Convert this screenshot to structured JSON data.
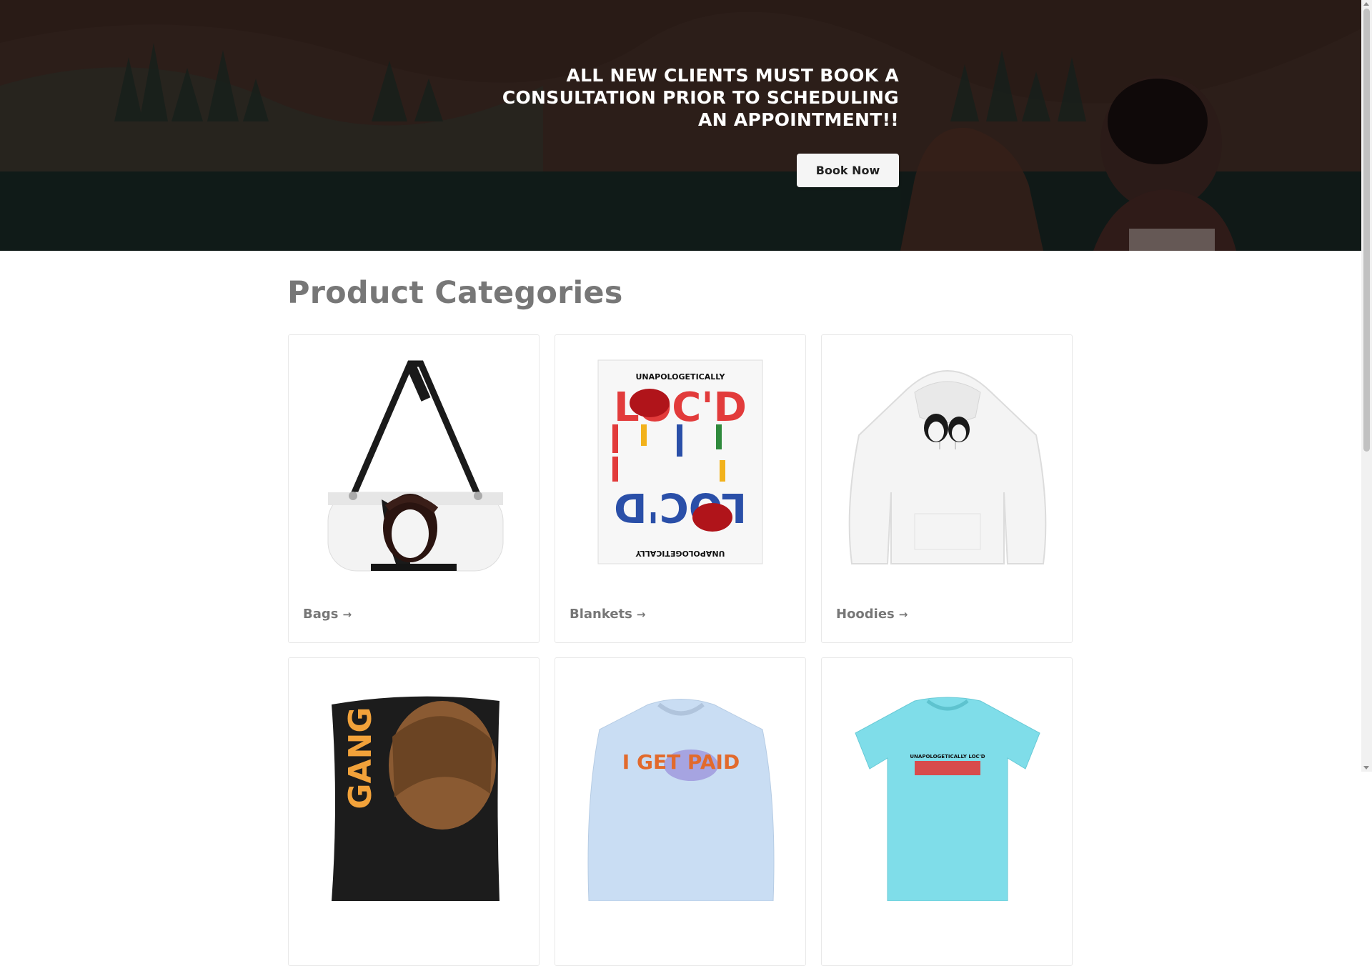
{
  "hero": {
    "heading": "ALL NEW CLIENTS MUST BOOK A CONSULTATION PRIOR TO SCHEDULING AN APPOINTMENT!!",
    "button_label": "Book Now"
  },
  "categories": {
    "title": "Product Categories",
    "items": [
      {
        "label": "Bags",
        "icon": "arrow-right-icon"
      },
      {
        "label": "Blankets",
        "icon": "arrow-right-icon"
      },
      {
        "label": "Hoodies",
        "icon": "arrow-right-icon"
      },
      {
        "label": "",
        "image_text": "GANG"
      },
      {
        "label": "",
        "image_text": "I GET PAID"
      },
      {
        "label": "",
        "image_text": "UNAPOLOGETICALLY LOC'D"
      }
    ],
    "blanket_text": {
      "top": "UNAPOLOGETICALLY",
      "word": "LOC'D"
    },
    "arrow_glyph": "→"
  },
  "colors": {
    "hero_bg": "#2b1c18",
    "title_gray": "#777777",
    "button_bg": "#f5f5f5",
    "shirt_blue": "#c9ddf3",
    "tee_cyan": "#7fdde9"
  }
}
